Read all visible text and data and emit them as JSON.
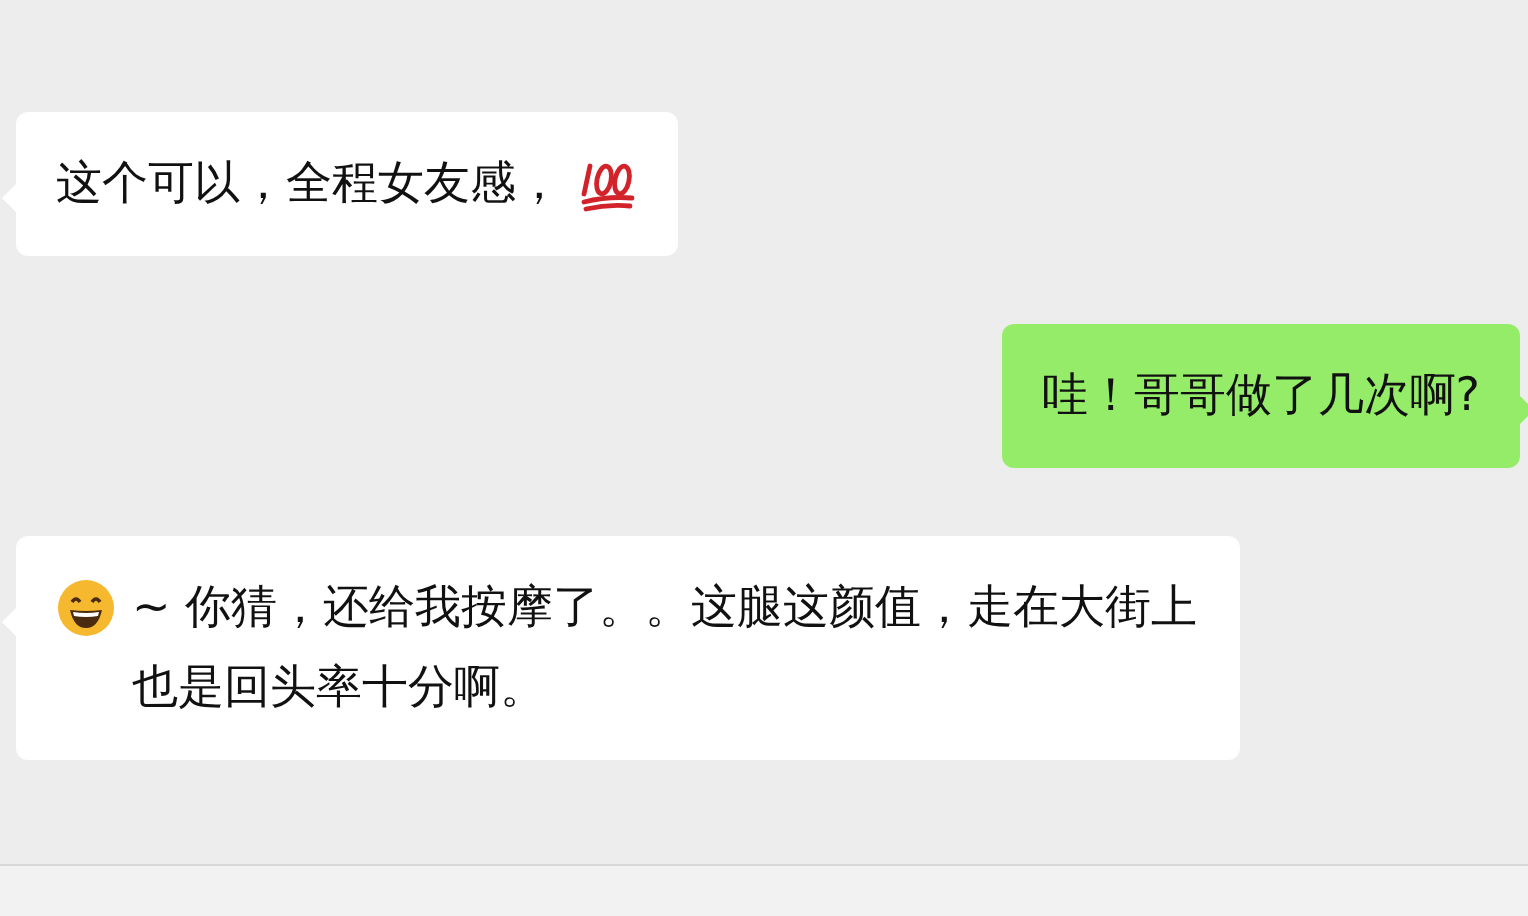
{
  "messages": [
    {
      "kind": "received",
      "parts": [
        {
          "kind": "text",
          "text": "这个可以，全程女友感，"
        },
        {
          "kind": "hundred"
        }
      ]
    },
    {
      "kind": "sent",
      "parts": [
        {
          "kind": "text",
          "text": "哇！哥哥做了几次啊?"
        }
      ]
    },
    {
      "kind": "received",
      "parts": [
        {
          "kind": "grin"
        },
        {
          "kind": "text",
          "text": "~ 你猜，还给我按摩了。。这腿这颜值，走在大街上也是回头率十分啊。"
        }
      ]
    }
  ]
}
